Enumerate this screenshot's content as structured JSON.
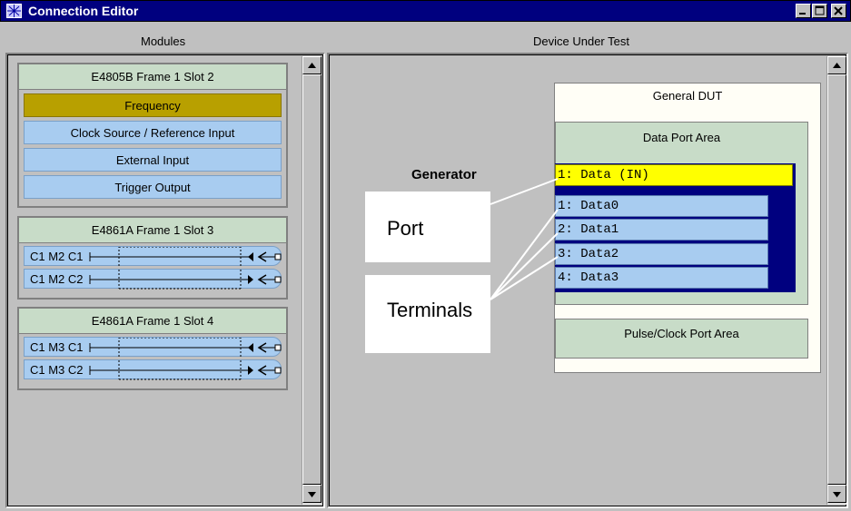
{
  "window": {
    "title": "Connection Editor"
  },
  "columns": {
    "modules": "Modules",
    "dut": "Device Under Test"
  },
  "modules": [
    {
      "header": "E4805B   Frame 1   Slot 2",
      "rows": [
        {
          "label": "Frequency",
          "selected": true
        },
        {
          "label": "Clock Source / Reference Input",
          "selected": false
        },
        {
          "label": "External Input",
          "selected": false
        },
        {
          "label": "Trigger Output",
          "selected": false
        }
      ]
    },
    {
      "header": "E4861A   Frame 1   Slot 3",
      "channels": [
        "C1 M2 C1",
        "C1 M2 C2"
      ]
    },
    {
      "header": "E4861A   Frame 1   Slot 4",
      "channels": [
        "C1 M3 C1",
        "C1 M3 C2"
      ]
    }
  ],
  "dut": {
    "title": "General DUT",
    "data_port_area": "Data Port Area",
    "port": "1: Data (IN)",
    "terminals": [
      "1: Data0",
      "2: Data1",
      "3: Data2",
      "4: Data3"
    ],
    "pulse_clock_area": "Pulse/Clock Port Area"
  },
  "annotations": {
    "generator": "Generator",
    "port": "Port",
    "terminals": "Terminals"
  },
  "colors": {
    "titlebar": "#00007f",
    "selected_row": "#b8a000",
    "row": "#a8ccf0",
    "area": "#c8dcc8",
    "port_highlight": "#ffff00"
  }
}
